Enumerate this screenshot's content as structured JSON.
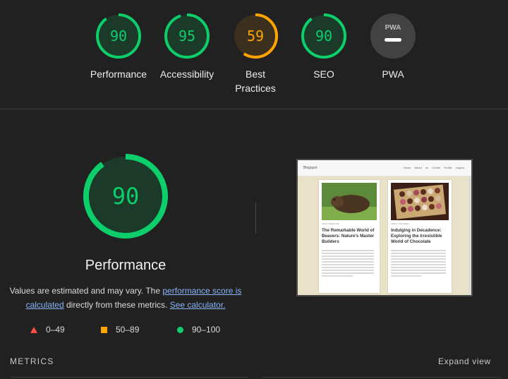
{
  "categories": [
    {
      "label": "Performance",
      "score": "90",
      "fraction": 0.9,
      "color": "#0ccf6b",
      "bg": "#1b3a2a"
    },
    {
      "label": "Accessibility",
      "score": "95",
      "fraction": 0.95,
      "color": "#0ccf6b",
      "bg": "#1b3a2a"
    },
    {
      "label": "Best\nPractices",
      "score": "59",
      "fraction": 0.59,
      "color": "#ffa400",
      "bg": "#3b2f1e"
    },
    {
      "label": "SEO",
      "score": "90",
      "fraction": 0.9,
      "color": "#0ccf6b",
      "bg": "#1b3a2a"
    },
    {
      "label": "PWA",
      "score": "",
      "fraction": 0,
      "color": "#ffffff",
      "bg": "#424242",
      "badge": "PWA",
      "icon": "pwa-dash-icon"
    }
  ],
  "performance": {
    "score": "90",
    "fraction": 0.9,
    "title": "Performance",
    "desc_prefix": "Values are estimated and may vary. The ",
    "desc_link1": "performance score is calculated",
    "desc_middle": " directly from these metrics. ",
    "desc_link2": "See calculator."
  },
  "legend": [
    {
      "range": "0–49",
      "icon": "triangle-red-icon",
      "color": "#ff4e42"
    },
    {
      "range": "50–89",
      "icon": "square-orange-icon",
      "color": "#ffa400"
    },
    {
      "range": "90–100",
      "icon": "circle-green-icon",
      "color": "#0ccf6b"
    }
  ],
  "screenshot": {
    "brand": "Blogspot",
    "nav_links": "Home About us Create Profile Logout",
    "cards": [
      {
        "tag": "Author: Beaver Elf",
        "title": "The Remarkable World of Beavers: Nature's Master Builders"
      },
      {
        "tag": "Author: Chocolatier",
        "title": "Indulging in Decadence: Exploring the Irresistible World of Chocolate"
      }
    ]
  },
  "metrics": {
    "label": "METRICS",
    "expand": "Expand view"
  }
}
